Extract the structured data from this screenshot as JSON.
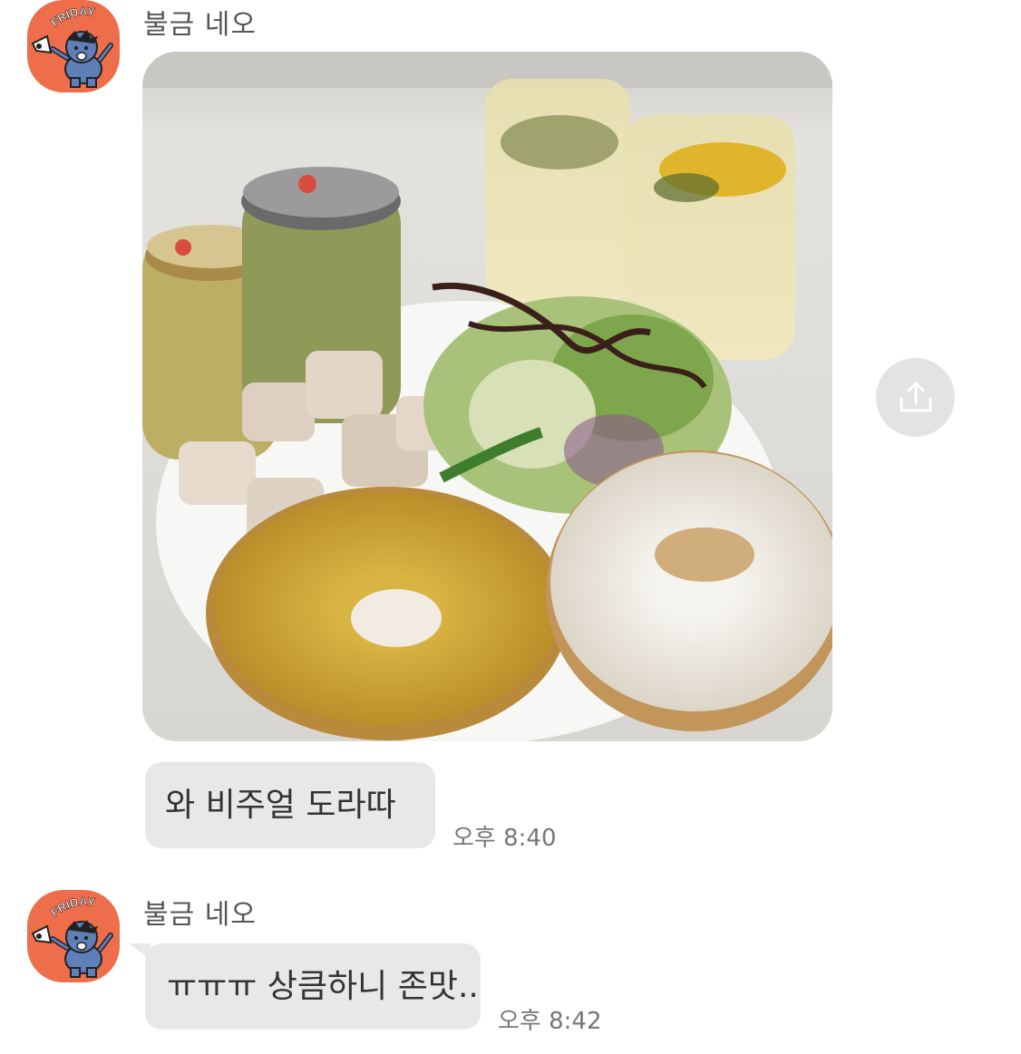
{
  "messages": [
    {
      "sender": "불금 네오",
      "avatar_icon": "friday-neo-character-icon",
      "photo_icon": "food-plate-photo",
      "bubble_text": "와 비주얼 도라따",
      "time": "오후 8:40"
    },
    {
      "sender": "불금 네오",
      "avatar_icon": "friday-neo-character-icon",
      "bubble_text": "ㅠㅠㅠ 상큼하니 존맛..",
      "time": "오후 8:42"
    }
  ],
  "share_icon": "share-icon",
  "colors": {
    "avatar_bg": "#ee6d4b",
    "bubble_bg": "#e8e8ea",
    "share_bg": "#e3e3e3"
  }
}
